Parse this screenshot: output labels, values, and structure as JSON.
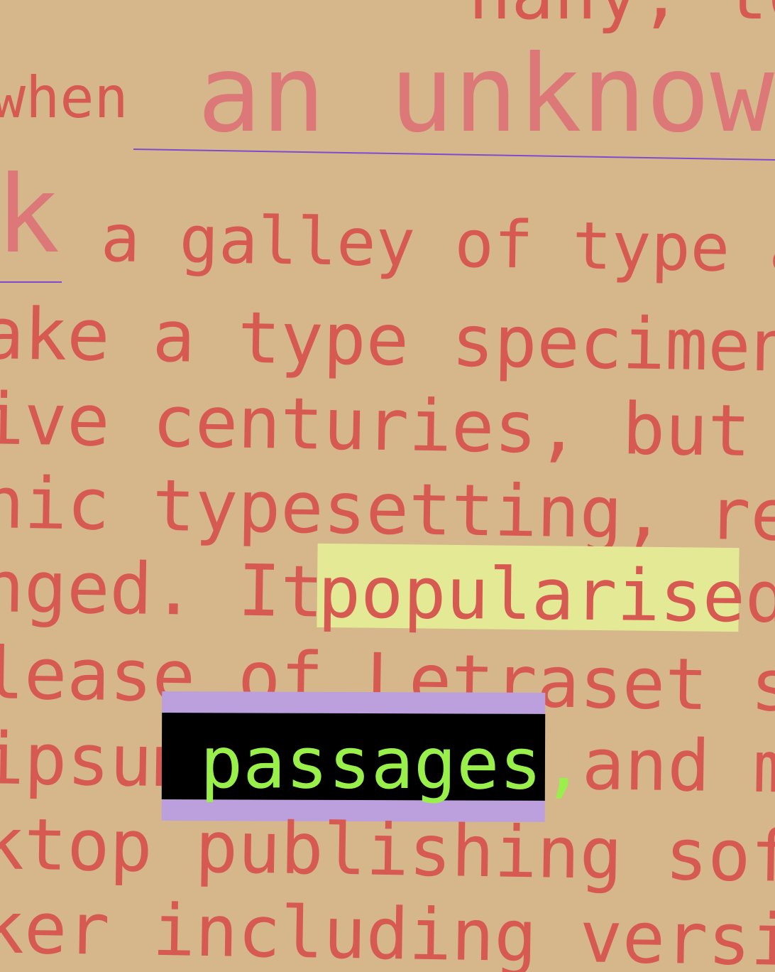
{
  "lines": {
    "l0": "nany, to",
    "l1a": "when",
    "l1b": "an unknown",
    "l2a": "k",
    "l2b": "a galley of type a",
    "l3": "ake a type specimen b",
    "l4": "ive centuries, but al",
    "l5": "nic typesetting, rema",
    "l6": "nged. It",
    "l6_highlight": "popularised",
    "l7": "lease of Letraset she",
    "l8a": "ipsum",
    "l8_chip": "passages,",
    "l8b": "and m",
    "l9": "ktop publishing softw",
    "l10": "ker including version"
  },
  "colors": {
    "background": "#d6b78c",
    "text": "#d65a52",
    "large_text": "#dc7878",
    "rule": "#7d4ccd",
    "highlight": "#e4e996",
    "chip_band": "#bba0dd",
    "chip_bg": "#000000",
    "chip_text": "#9af04a"
  }
}
